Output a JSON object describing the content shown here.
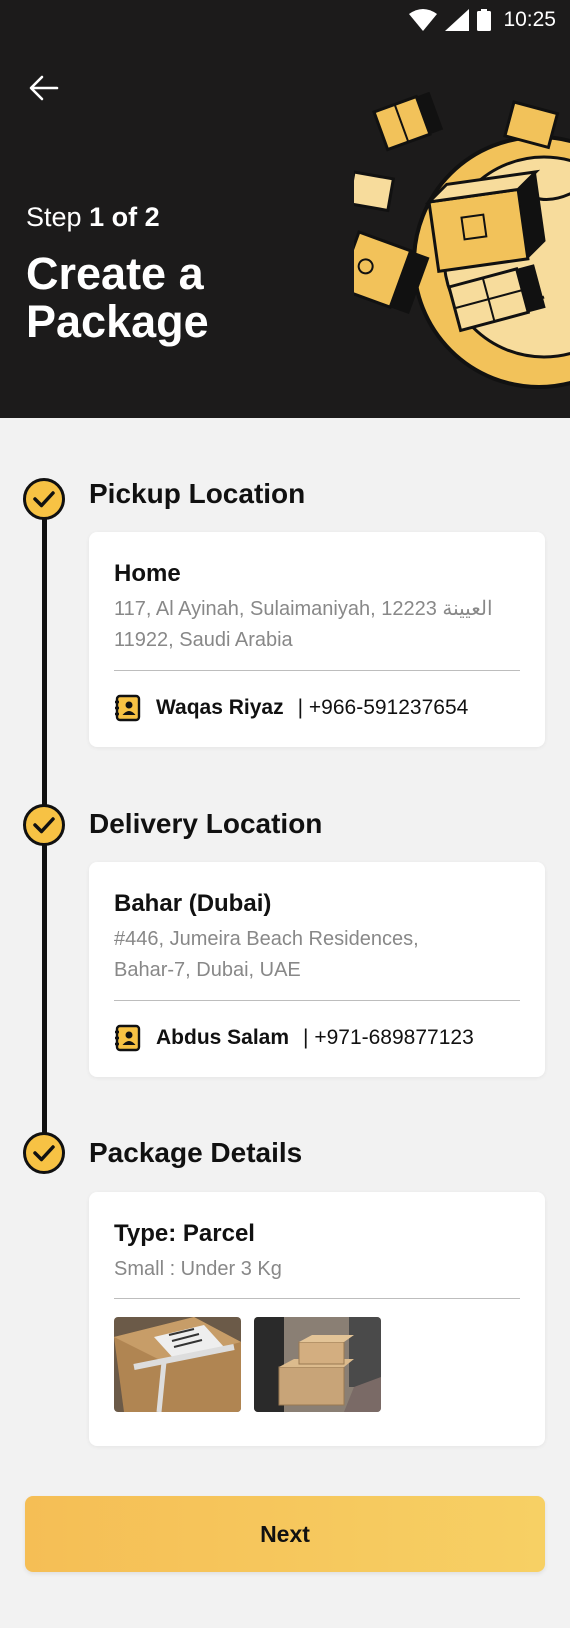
{
  "status_bar": {
    "time": "10:25"
  },
  "header": {
    "step_prefix": "Step",
    "step_value": "1 of 2",
    "title": "Create a Package"
  },
  "pickup": {
    "section_title": "Pickup Location",
    "place_name": "Home",
    "address": "117, Al Ayinah, Sulaimaniyah, 12223 العيينة 11922, Saudi Arabia",
    "contact_name": "Waqas Riyaz",
    "contact_phone": "| +966-591237654"
  },
  "delivery": {
    "section_title": "Delivery Location",
    "place_name": "Bahar (Dubai)",
    "address": "#446, Jumeira Beach Residences, Bahar-7, Dubai, UAE",
    "contact_name": "Abdus Salam",
    "contact_phone": "| +971-689877123"
  },
  "package": {
    "section_title": "Package Details",
    "type": "Type: Parcel",
    "size": "Small : Under 3 Kg"
  },
  "next_label": "Next",
  "colors": {
    "accent": "#f5be55",
    "dark": "#1c1b1b",
    "icon_yellow": "#f7c244"
  }
}
